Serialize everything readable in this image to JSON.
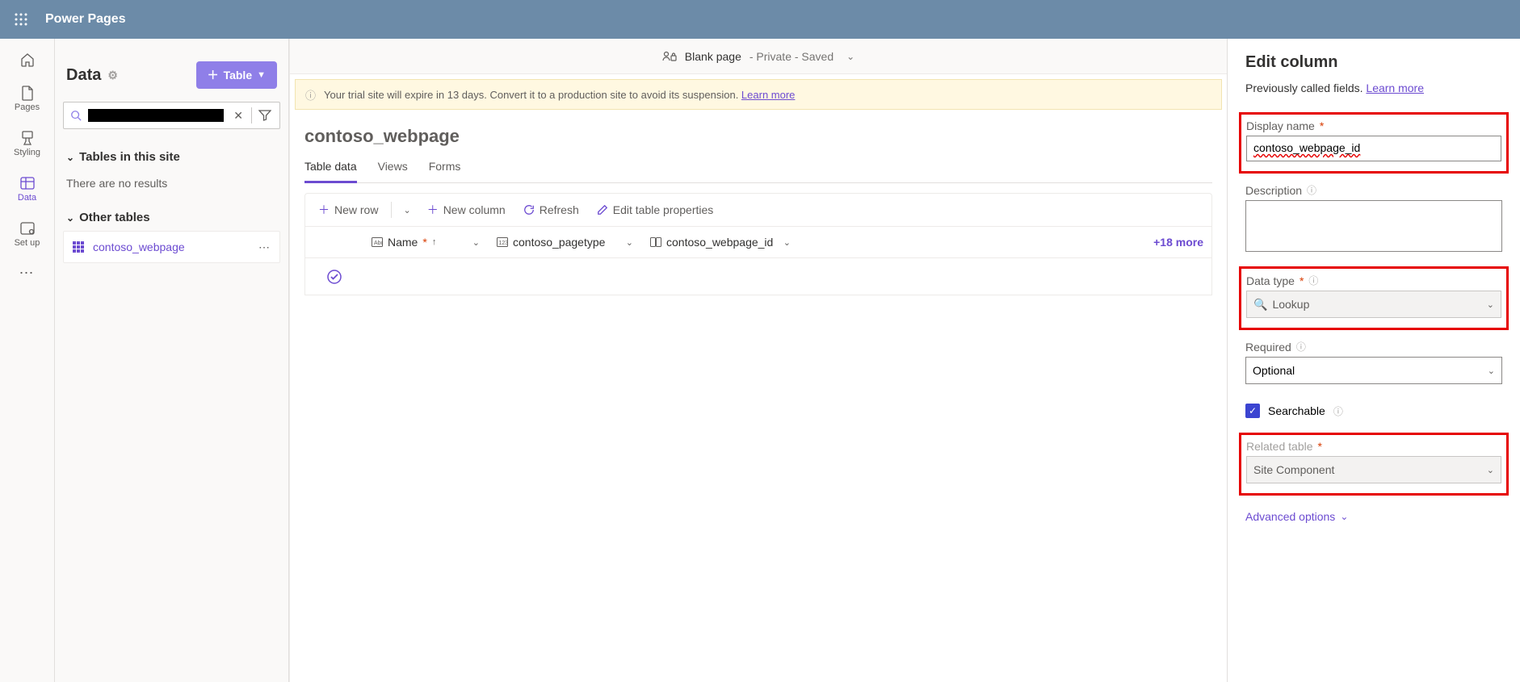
{
  "app": {
    "brand": "Power Pages"
  },
  "rail": {
    "items": [
      {
        "label": "Pages"
      },
      {
        "label": "Styling"
      },
      {
        "label": "Data"
      },
      {
        "label": "Set up"
      }
    ]
  },
  "sidepanel": {
    "title": "Data",
    "new_table_label": "Table",
    "sections": {
      "site_tables": "Tables in this site",
      "other_tables": "Other tables"
    },
    "no_results": "There are no results",
    "other_table_name": "contoso_webpage"
  },
  "pagebar": {
    "page_name": "Blank page",
    "status": " - Private - Saved"
  },
  "banner": {
    "text": "Your trial site will expire in 13 days. Convert it to a production site to avoid its suspension. ",
    "link": "Learn more"
  },
  "main_table": {
    "title": "contoso_webpage",
    "tabs": [
      "Table data",
      "Views",
      "Forms"
    ],
    "cmds": {
      "new_row": "New row",
      "new_column": "New column",
      "refresh": "Refresh",
      "edit_props": "Edit table properties"
    },
    "columns": {
      "name": "Name",
      "pagetype": "contoso_pagetype",
      "webpage": "contoso_webpage_id"
    },
    "more_cols": "+18 more"
  },
  "right": {
    "title": "Edit column",
    "subtitle_prefix": "Previously called fields. ",
    "learn_more": "Learn more",
    "labels": {
      "display_name": "Display name",
      "description": "Description",
      "data_type": "Data type",
      "required": "Required",
      "searchable": "Searchable",
      "related_table": "Related table",
      "advanced": "Advanced options"
    },
    "values": {
      "display_name": "contoso_webpage_id",
      "data_type": "Lookup",
      "required": "Optional",
      "related_table": "Site Component"
    }
  }
}
